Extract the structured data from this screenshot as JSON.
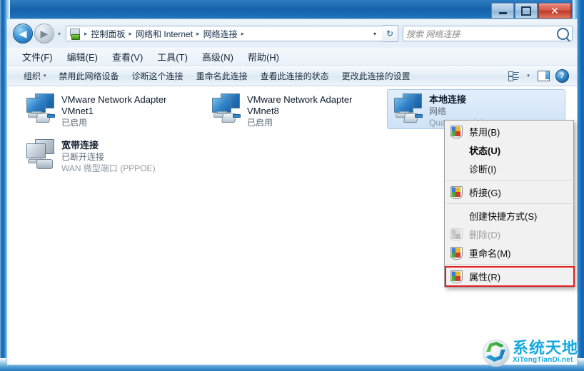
{
  "window": {
    "title": "",
    "controls": {
      "minimize_label": "最小化",
      "maximize_label": "最大化",
      "close_label": "关闭",
      "close_glyph": "✕"
    }
  },
  "addressbar": {
    "back_label": "后退",
    "back_glyph": "◀",
    "forward_label": "前进",
    "forward_glyph": "▶",
    "recent_pages_glyph": "▾",
    "breadcrumb_icon": "control-panel-network-icon",
    "crumbs": [
      "控制面板",
      "网络和 Internet",
      "网络连接"
    ],
    "crumb_separator": "▸",
    "dropdown_glyph": "▾",
    "refresh_glyph": "↻",
    "refresh_label": "刷新"
  },
  "search": {
    "placeholder": "搜索 网络连接",
    "value": "",
    "icon": "search-icon"
  },
  "menubar": {
    "items": [
      {
        "label": "文件(F)"
      },
      {
        "label": "编辑(E)"
      },
      {
        "label": "查看(V)"
      },
      {
        "label": "工具(T)"
      },
      {
        "label": "高级(N)"
      },
      {
        "label": "帮助(H)"
      }
    ]
  },
  "toolbar": {
    "organize_label": "组织",
    "organize_caret": "▾",
    "buttons": [
      {
        "label": "禁用此网络设备"
      },
      {
        "label": "诊断这个连接"
      },
      {
        "label": "重命名此连接"
      },
      {
        "label": "查看此连接的状态"
      },
      {
        "label": "更改此连接的设置"
      }
    ],
    "view_mode_caret": "▾",
    "view_mode_label": "更改您的视图",
    "preview_pane_label": "显示预览窗格",
    "help_label": "获取帮助",
    "help_glyph": "?"
  },
  "connections": [
    {
      "name": "VMware Network Adapter",
      "name_line2": "VMnet1",
      "status": "已启用",
      "detail": "",
      "icon": "network-adapter-icon",
      "state": "enabled",
      "selected": false
    },
    {
      "name": "VMware Network Adapter",
      "name_line2": "VMnet8",
      "status": "已启用",
      "detail": "",
      "icon": "network-adapter-icon",
      "state": "enabled",
      "selected": false
    },
    {
      "name": "本地连接",
      "name_line2": "",
      "status": "网络",
      "detail": "Qualcomm Atheros",
      "icon": "network-adapter-icon",
      "state": "enabled",
      "selected": true
    },
    {
      "name": "宽带连接",
      "name_line2": "",
      "status": "已断开连接",
      "detail": "WAN 微型端口 (PPPOE)",
      "icon": "wan-miniport-icon",
      "state": "disconnected",
      "selected": false
    }
  ],
  "context_menu": {
    "items": [
      {
        "label": "禁用(B)",
        "shield": true,
        "bold": false,
        "disabled": false,
        "highlighted": false
      },
      {
        "label": "状态(U)",
        "shield": false,
        "bold": true,
        "disabled": false,
        "highlighted": false
      },
      {
        "label": "诊断(I)",
        "shield": false,
        "bold": false,
        "disabled": false,
        "highlighted": false
      },
      {
        "separator": true
      },
      {
        "label": "桥接(G)",
        "shield": true,
        "bold": false,
        "disabled": false,
        "highlighted": false
      },
      {
        "separator": true
      },
      {
        "label": "创建快捷方式(S)",
        "shield": false,
        "bold": false,
        "disabled": false,
        "highlighted": false
      },
      {
        "label": "删除(D)",
        "shield": true,
        "shield_dim": true,
        "bold": false,
        "disabled": true,
        "highlighted": false
      },
      {
        "label": "重命名(M)",
        "shield": true,
        "bold": false,
        "disabled": false,
        "highlighted": false
      },
      {
        "separator": true
      },
      {
        "label": "属性(R)",
        "shield": true,
        "bold": false,
        "disabled": false,
        "highlighted": true
      }
    ]
  },
  "watermark": {
    "chinese": "系统天地",
    "english": "XiTongTianDi.net",
    "logo": "swoosh-circle-logo"
  },
  "colors": {
    "accent_blue": "#1763ac",
    "selection_blue": "#cfe2f7",
    "close_red": "#bc3a27",
    "highlight_red": "#e02020",
    "watermark_cyan": "#18a9e0"
  }
}
